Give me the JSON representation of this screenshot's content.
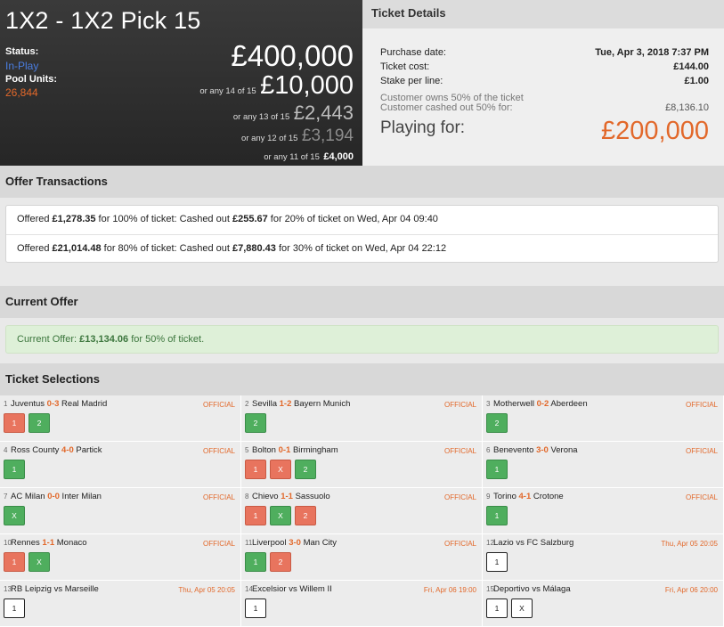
{
  "pool": {
    "title": "1X2 - 1X2 Pick 15",
    "status_label": "Status:",
    "status_value": "In-Play",
    "units_label": "Pool Units:",
    "units_value": "26,844",
    "main_prize": "£400,000",
    "tiers": [
      {
        "prefix": "or any 14 of 15",
        "amount": "£10,000"
      },
      {
        "prefix": "or any 13 of 15",
        "amount": "£2,443"
      },
      {
        "prefix": "or any 12 of 15",
        "amount": "£3,194"
      },
      {
        "prefix": "or any 11 of 15",
        "amount": "£4,000"
      }
    ]
  },
  "ticket": {
    "heading": "Ticket Details",
    "purchase_label": "Purchase date:",
    "purchase_value": "Tue, Apr 3, 2018 7:37 PM",
    "cost_label": "Ticket cost:",
    "cost_value": "£144.00",
    "stake_label": "Stake per line:",
    "stake_value": "£1.00",
    "owns_text": "Customer owns 50% of the ticket",
    "cashed_label": "Customer cashed out 50% for:",
    "cashed_value": "£8,136.10",
    "playing_label": "Playing for:",
    "playing_value": "£200,000"
  },
  "offers": {
    "heading": "Offer Transactions",
    "rows": [
      {
        "p1": "Offered ",
        "b1": "£1,278.35",
        "p2": " for 100% of ticket: Cashed out ",
        "b2": "£255.67",
        "p3": " for 20% of ticket on Wed, Apr 04 09:40"
      },
      {
        "p1": "Offered ",
        "b1": "£21,014.48",
        "p2": " for 80% of ticket: Cashed out ",
        "b2": "£7,880.43",
        "p3": " for 30% of ticket on Wed, Apr 04 22:12"
      }
    ]
  },
  "current": {
    "heading": "Current Offer",
    "p1": "Current Offer: ",
    "b1": "£13,134.06",
    "p2": " for 50% of ticket."
  },
  "selections": {
    "heading": "Ticket Selections",
    "items": [
      {
        "num": "1",
        "home": "Juventus",
        "score": "0-3",
        "away": "Real Madrid",
        "status": "OFFICIAL",
        "picks": [
          {
            "t": "1",
            "c": "red"
          },
          {
            "t": "2",
            "c": "green"
          }
        ]
      },
      {
        "num": "2",
        "home": "Sevilla",
        "score": "1-2",
        "away": "Bayern Munich",
        "status": "OFFICIAL",
        "picks": [
          {
            "t": "2",
            "c": "green"
          }
        ]
      },
      {
        "num": "3",
        "home": "Motherwell",
        "score": "0-2",
        "away": "Aberdeen",
        "status": "OFFICIAL",
        "picks": [
          {
            "t": "2",
            "c": "green"
          }
        ]
      },
      {
        "num": "4",
        "home": "Ross County",
        "score": "4-0",
        "away": "Partick",
        "status": "OFFICIAL",
        "picks": [
          {
            "t": "1",
            "c": "green"
          }
        ]
      },
      {
        "num": "5",
        "home": "Bolton",
        "score": "0-1",
        "away": "Birmingham",
        "status": "OFFICIAL",
        "picks": [
          {
            "t": "1",
            "c": "red"
          },
          {
            "t": "X",
            "c": "red"
          },
          {
            "t": "2",
            "c": "green"
          }
        ]
      },
      {
        "num": "6",
        "home": "Benevento",
        "score": "3-0",
        "away": "Verona",
        "status": "OFFICIAL",
        "picks": [
          {
            "t": "1",
            "c": "green"
          }
        ]
      },
      {
        "num": "7",
        "home": "AC Milan",
        "score": "0-0",
        "away": "Inter Milan",
        "status": "OFFICIAL",
        "picks": [
          {
            "t": "X",
            "c": "green"
          }
        ]
      },
      {
        "num": "8",
        "home": "Chievo",
        "score": "1-1",
        "away": "Sassuolo",
        "status": "OFFICIAL",
        "picks": [
          {
            "t": "1",
            "c": "red"
          },
          {
            "t": "X",
            "c": "green"
          },
          {
            "t": "2",
            "c": "red"
          }
        ]
      },
      {
        "num": "9",
        "home": "Torino",
        "score": "4-1",
        "away": "Crotone",
        "status": "OFFICIAL",
        "picks": [
          {
            "t": "1",
            "c": "green"
          }
        ]
      },
      {
        "num": "10",
        "home": "Rennes",
        "score": "1-1",
        "away": "Monaco",
        "status": "OFFICIAL",
        "picks": [
          {
            "t": "1",
            "c": "red"
          },
          {
            "t": "X",
            "c": "green"
          }
        ]
      },
      {
        "num": "11",
        "home": "Liverpool",
        "score": "3-0",
        "away": "Man City",
        "status": "OFFICIAL",
        "picks": [
          {
            "t": "1",
            "c": "green"
          },
          {
            "t": "2",
            "c": "red"
          }
        ]
      },
      {
        "num": "12",
        "home": "Lazio",
        "score": "vs",
        "away": "FC Salzburg",
        "status": "Thu, Apr 05 20:05",
        "picks": [
          {
            "t": "1",
            "c": "white"
          }
        ]
      },
      {
        "num": "13",
        "home": "RB Leipzig",
        "score": "vs",
        "away": "Marseille",
        "status": "Thu, Apr 05 20:05",
        "picks": [
          {
            "t": "1",
            "c": "white"
          }
        ]
      },
      {
        "num": "14",
        "home": "Excelsior",
        "score": "vs",
        "away": "Willem II",
        "status": "Fri, Apr 06 19:00",
        "picks": [
          {
            "t": "1",
            "c": "white"
          }
        ]
      },
      {
        "num": "15",
        "home": "Deportivo",
        "score": "vs",
        "away": "Málaga",
        "status": "Fri, Apr 06 20:00",
        "picks": [
          {
            "t": "1",
            "c": "white"
          },
          {
            "t": "X",
            "c": "white"
          }
        ]
      }
    ]
  }
}
